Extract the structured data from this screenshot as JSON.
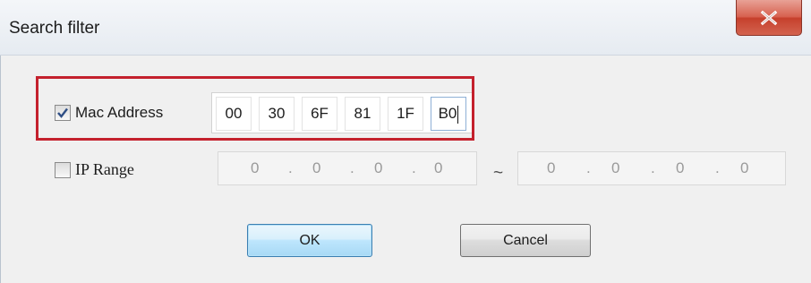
{
  "window": {
    "title": "Search filter",
    "close_icon": "close-icon"
  },
  "mac_filter": {
    "checked": true,
    "label": "Mac Address",
    "octets": [
      "00",
      "30",
      "6F",
      "81",
      "1F",
      "B0"
    ]
  },
  "ip_filter": {
    "checked": false,
    "label": "IP Range",
    "start": [
      "0",
      "0",
      "0",
      "0"
    ],
    "end": [
      "0",
      "0",
      "0",
      "0"
    ],
    "separator": "~"
  },
  "buttons": {
    "ok": "OK",
    "cancel": "Cancel"
  },
  "colors": {
    "highlight": "#c4212d",
    "close_button": "#c6402c"
  }
}
